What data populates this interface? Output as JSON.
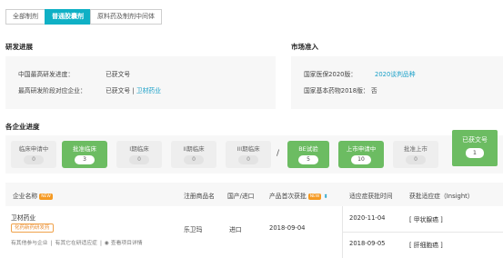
{
  "tabs": [
    {
      "label": "全部制剂"
    },
    {
      "label": "普通胶囊剂"
    },
    {
      "label": "原料药及制剂中间体"
    }
  ],
  "rd_progress": {
    "title": "研发进展",
    "rows": [
      {
        "key": "中国最高研发进度：",
        "value": "已获文号",
        "link": ""
      },
      {
        "key": "最高研发阶段对应企业：",
        "value": "已获文号 | ",
        "link": "卫材药业"
      }
    ]
  },
  "market_access": {
    "title": "市场准入",
    "rows": [
      {
        "key": "国家医保2020版：",
        "value": "",
        "link": "2020谈判品种"
      },
      {
        "key": "国家基本药物2018版：",
        "value": "否",
        "link": ""
      }
    ]
  },
  "pipeline": {
    "title": "各企业进度",
    "separator": "/",
    "stages": [
      {
        "label": "临床申请中",
        "count": "0",
        "active": false
      },
      {
        "label": "批准临床",
        "count": "3",
        "active": true
      },
      {
        "label": "I期临床",
        "count": "0",
        "active": false
      },
      {
        "label": "II期临床",
        "count": "0",
        "active": false
      },
      {
        "label": "III期临床",
        "count": "0",
        "active": false
      },
      {
        "label": "BE试验",
        "count": "5",
        "active": true
      },
      {
        "label": "上市申请中",
        "count": "10",
        "active": true
      },
      {
        "label": "批准上市",
        "count": "0",
        "active": false
      }
    ],
    "final": {
      "label": "已获文号",
      "count": "1"
    }
  },
  "table": {
    "headers": {
      "company": "企业名称",
      "new_tag": "NEW",
      "brand": "注册商品名",
      "origin": "国产/进口",
      "first_approval": "产品首次获批",
      "indication_time": "适应症获批时间",
      "indication": "获批适应症（Insight）"
    },
    "rows": [
      {
        "company": "卫材药业",
        "tag": "化药新药研发药",
        "sublinks": [
          "有其他参与企业",
          "有其它在研适应症",
          "查看项目详情"
        ],
        "brand": "乐卫玛",
        "origin": "进口",
        "first_approval": "2018-09-04",
        "approvals": [
          {
            "date": "2020-11-04",
            "indication": "[ 甲状腺癌 ]"
          },
          {
            "date": "2018-09-05",
            "indication": "[ 肝细胞癌 ]"
          }
        ]
      }
    ]
  },
  "colors": {
    "accent": "#0fb0c5",
    "stage_active": "#6cbc62",
    "link": "#1aa0c8",
    "tag": "#e88a2d"
  }
}
